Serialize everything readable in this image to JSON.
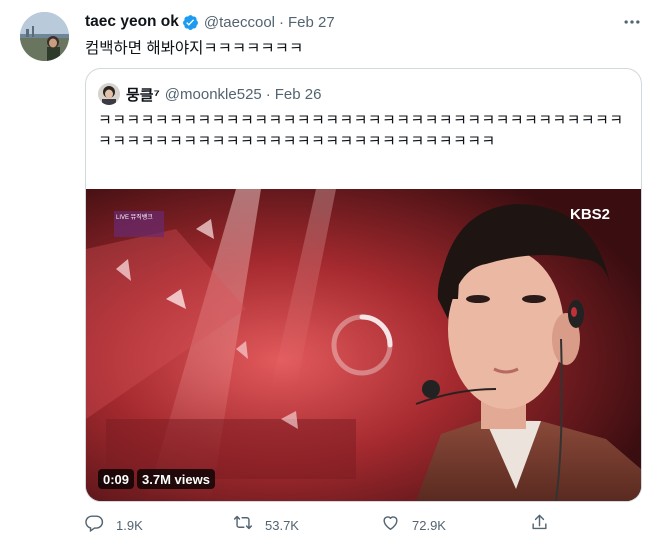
{
  "tweet": {
    "display_name": "taec yeon ok",
    "handle": "@taeccool",
    "separator": "·",
    "date": "Feb 27",
    "text": "컴백하면 해봐야지ㅋㅋㅋㅋㅋㅋㅋ",
    "verified": true
  },
  "quoted": {
    "display_name": "뭉클⁷",
    "handle": "@moonkle525",
    "separator": "·",
    "date": "Feb 26",
    "text": "ㅋㅋㅋㅋㅋㅋㅋㅋㅋㅋㅋㅋㅋㅋㅋㅋㅋㅋㅋㅋㅋㅋㅋㅋㅋㅋㅋㅋㅋㅋㅋㅋㅋㅋㅋㅋㅋㅋㅋㅋㅋㅋㅋㅋㅋㅋㅋㅋㅋㅋㅋㅋㅋㅋㅋㅋㅋㅋㅋㅋㅋㅋㅋㅋㅋ",
    "video": {
      "time": "0:09",
      "views": "3.7M views",
      "broadcaster_logo": "KBS2",
      "show_logo": "LIVE 뮤직뱅크"
    }
  },
  "actions": {
    "replies": "1.9K",
    "retweets": "53.7K",
    "likes": "72.9K"
  },
  "icons": {
    "reply": "speech-bubble-icon",
    "retweet": "retweet-arrows-icon",
    "like": "heart-icon",
    "share": "share-upload-icon",
    "more": "more-dots-icon",
    "verified": "verified-badge-icon"
  },
  "colors": {
    "verified": "#1d9bf0",
    "text": "#0f1419",
    "secondary": "#536471",
    "border": "#cfd9de"
  }
}
